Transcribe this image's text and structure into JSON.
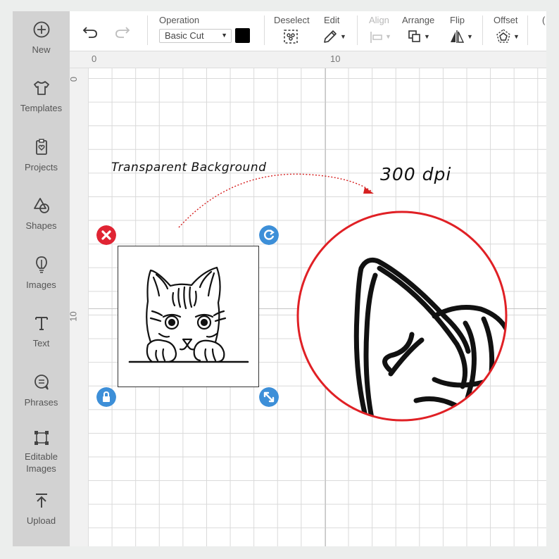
{
  "sidebar": {
    "items": [
      {
        "label": "New",
        "icon": "plus-circle-icon"
      },
      {
        "label": "Templates",
        "icon": "tshirt-icon"
      },
      {
        "label": "Projects",
        "icon": "clipboard-heart-icon"
      },
      {
        "label": "Shapes",
        "icon": "shapes-icon"
      },
      {
        "label": "Images",
        "icon": "lightbulb-icon"
      },
      {
        "label": "Text",
        "icon": "text-icon"
      },
      {
        "label": "Phrases",
        "icon": "speech-bubble-icon"
      },
      {
        "label": "Editable Images",
        "icon": "editable-image-icon"
      },
      {
        "label": "Upload",
        "icon": "upload-icon"
      }
    ]
  },
  "toolbar": {
    "operation_label": "Operation",
    "operation_value": "Basic Cut",
    "deselect_label": "Deselect",
    "edit_label": "Edit",
    "align_label": "Align",
    "arrange_label": "Arrange",
    "flip_label": "Flip",
    "offset_label": "Offset",
    "swatch_color": "#000000"
  },
  "ruler": {
    "top": [
      "0",
      "10"
    ],
    "left": [
      "0",
      "10"
    ]
  },
  "annotations": {
    "background_note": "Transparent Background",
    "dpi_note": "300 dpi"
  },
  "colors": {
    "delete_handle": "#e02433",
    "handle_blue": "#3d8fd8",
    "zoom_ring": "#e02025"
  }
}
